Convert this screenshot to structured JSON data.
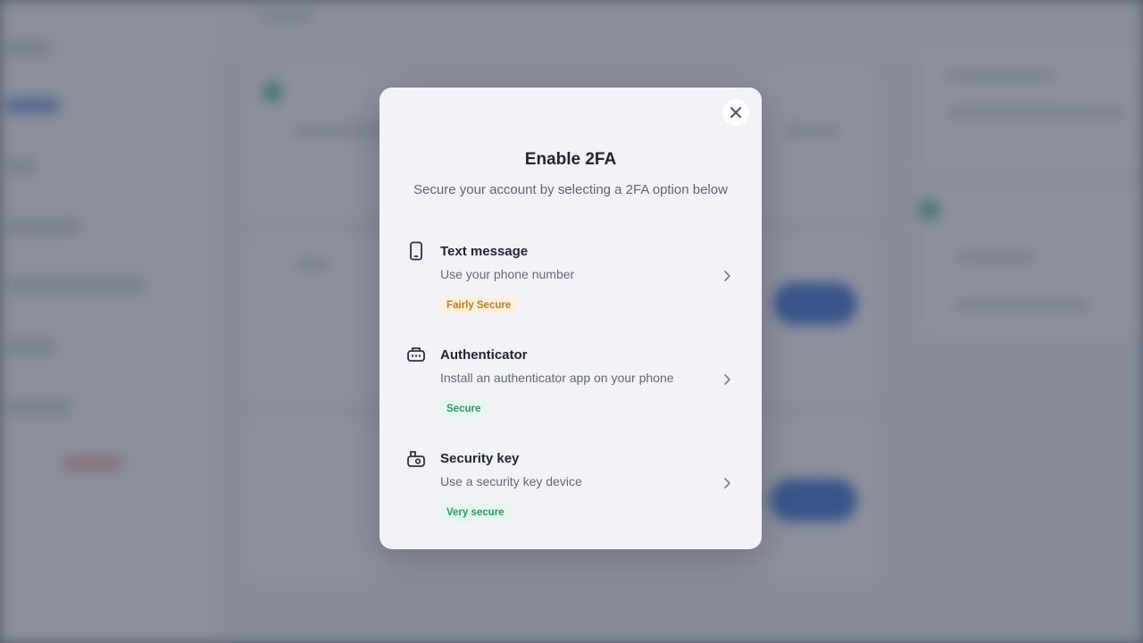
{
  "modal": {
    "title": "Enable 2FA",
    "subtitle": "Secure your account by selecting a 2FA option below",
    "close_icon": "close-icon",
    "options": [
      {
        "icon": "phone-icon",
        "title": "Text message",
        "description": "Use your phone number",
        "badge": "Fairly Secure",
        "badge_color": "#c47a18"
      },
      {
        "icon": "authenticator-icon",
        "title": "Authenticator",
        "description": "Install an authenticator app on your phone",
        "badge": "Secure",
        "badge_color": "#1f9e63"
      },
      {
        "icon": "security-key-icon",
        "title": "Security key",
        "description": "Use a security key device",
        "badge": "Very secure",
        "badge_color": "#1f9e63"
      }
    ]
  },
  "colors": {
    "overlay": "#3a4052",
    "modal_bg": "#f1f3f8",
    "warning": "#c47a18",
    "success": "#1f9e63"
  }
}
